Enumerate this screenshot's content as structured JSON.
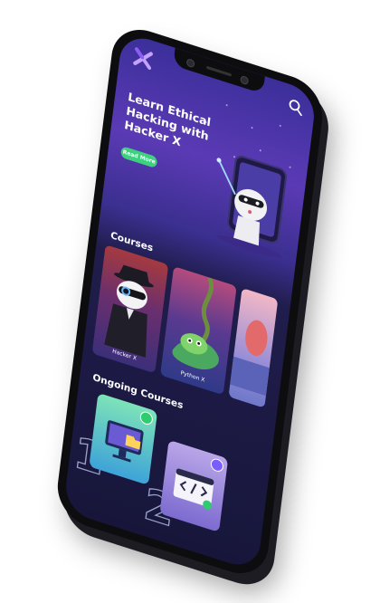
{
  "hero": {
    "title": "Learn Ethical Hacking with Hacker X",
    "button_label": "Read More"
  },
  "sections": {
    "courses_title": "Courses",
    "ongoing_title": "Ongoing Courses"
  },
  "courses": [
    {
      "label": "Hacker X"
    },
    {
      "label": "Python X"
    }
  ],
  "ongoing": [
    {
      "number": "1"
    },
    {
      "number": "2"
    }
  ],
  "colors": {
    "accent_green": "#3ed07f",
    "screen_top": "#5b3ab5",
    "screen_bottom": "#17163a"
  },
  "icons": {
    "logo": "x-logo-icon",
    "search": "search-icon"
  }
}
